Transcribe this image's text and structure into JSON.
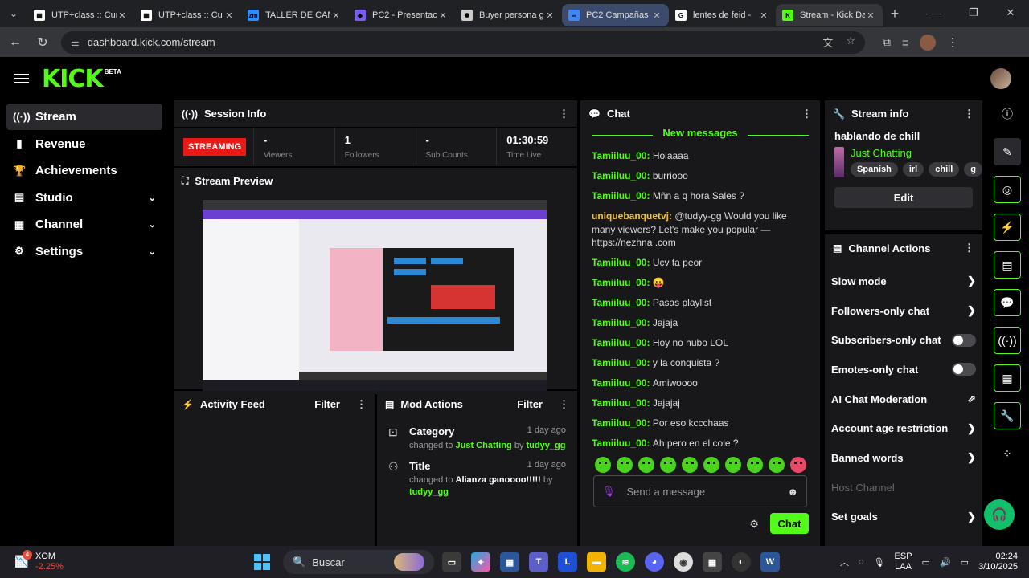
{
  "browser": {
    "tabs": [
      {
        "label": "UTP+class :: Cur",
        "fav_color": "#ffffff",
        "fav_char": "▦"
      },
      {
        "label": "UTP+class :: Cur",
        "fav_color": "#ffffff",
        "fav_char": "▦"
      },
      {
        "label": "TALLER DE CAM",
        "fav_color": "#2d8cff",
        "fav_char": "zm"
      },
      {
        "label": "PC2 - Presentaci",
        "fav_color": "#7b5cf0",
        "fav_char": "◆"
      },
      {
        "label": "Buyer persona g",
        "fav_color": "#cccccc",
        "fav_char": "✺"
      },
      {
        "label": "PC2 Campañas",
        "fav_color": "#4285f4",
        "fav_char": "≡"
      },
      {
        "label": "lentes de feid - ",
        "fav_color": "#ffffff",
        "fav_char": "G"
      },
      {
        "label": "Stream - Kick Da",
        "fav_color": "#53fc18",
        "fav_char": "K"
      }
    ],
    "url": "dashboard.kick.com/stream"
  },
  "app": {
    "logo": "KICK",
    "beta": "BETA",
    "nav": [
      {
        "label": "Stream",
        "icon": "((·))",
        "chevron": ""
      },
      {
        "label": "Revenue",
        "icon": "▮",
        "chevron": ""
      },
      {
        "label": "Achievements",
        "icon": "🏆",
        "chevron": ""
      },
      {
        "label": "Studio",
        "icon": "▤",
        "chevron": "⌄"
      },
      {
        "label": "Channel",
        "icon": "▦",
        "chevron": "⌄"
      },
      {
        "label": "Settings",
        "icon": "⚙",
        "chevron": "⌄"
      }
    ]
  },
  "session": {
    "title": "Session Info",
    "status": "STREAMING",
    "stats": [
      {
        "value": "-",
        "label": "Viewers"
      },
      {
        "value": "1",
        "label": "Followers"
      },
      {
        "value": "-",
        "label": "Sub Counts"
      },
      {
        "value": "01:30:59",
        "label": "Time Live"
      }
    ]
  },
  "preview": {
    "title": "Stream Preview"
  },
  "activity": {
    "title": "Activity Feed",
    "filter": "Filter"
  },
  "mod": {
    "title": "Mod Actions",
    "filter": "Filter",
    "entries": [
      {
        "title": "Category",
        "time": "1 day ago",
        "prefix": "changed to ",
        "value": "Just Chatting",
        "by": " by ",
        "user": "tudyy_gg"
      },
      {
        "title": "Title",
        "time": "1 day ago",
        "prefix": "changed to ",
        "value": "Alianza ganoooo!!!!!",
        "by": " by ",
        "user": "tudyy_gg"
      }
    ]
  },
  "chat": {
    "title": "Chat",
    "new_messages": "New messages",
    "messages": [
      {
        "user": "Tamiiluu_00",
        "text": "Holaaaa"
      },
      {
        "user": "Tamiiluu_00",
        "text": "burriooo"
      },
      {
        "user": "Tamiiluu_00",
        "text": "Mñn a q hora Sales ?"
      },
      {
        "user": "uniquebanquetvj",
        "text": "@tudyy-gg Would you like many viewers? Let's make you popular — https://nezhna .com"
      },
      {
        "user": "Tamiiluu_00",
        "text": "Ucv ta peor"
      },
      {
        "user": "Tamiiluu_00",
        "text": "😛"
      },
      {
        "user": "Tamiiluu_00",
        "text": "Pasas playlist"
      },
      {
        "user": "Tamiiluu_00",
        "text": "Jajaja"
      },
      {
        "user": "Tamiiluu_00",
        "text": "Hoy no hubo LOL"
      },
      {
        "user": "Tamiiluu_00",
        "text": "y la conquista ?"
      },
      {
        "user": "Tamiiluu_00",
        "text": "Amiwoooo"
      },
      {
        "user": "Tamiiluu_00",
        "text": "Jajajaj"
      },
      {
        "user": "Tamiiluu_00",
        "text": "Por eso kccchaas"
      },
      {
        "user": "Tamiiluu_00",
        "text": "Ah pero en el cole ?"
      }
    ],
    "placeholder": "Send a message",
    "send_label": "Chat"
  },
  "stream_info": {
    "title": "Stream info",
    "stream_title": "hablando de chill",
    "category": "Just Chatting",
    "tags": [
      "Spanish",
      "irl",
      "chill",
      "g"
    ],
    "edit_label": "Edit"
  },
  "channel_actions": {
    "title": "Channel Actions",
    "items": [
      {
        "label": "Slow mode",
        "control": "arrow"
      },
      {
        "label": "Followers-only chat",
        "control": "arrow"
      },
      {
        "label": "Subscribers-only chat",
        "control": "toggle"
      },
      {
        "label": "Emotes-only chat",
        "control": "toggle"
      },
      {
        "label": "AI Chat Moderation",
        "control": "external"
      },
      {
        "label": "Account age restriction",
        "control": "arrow"
      },
      {
        "label": "Banned words",
        "control": "arrow"
      },
      {
        "label": "Host Channel",
        "control": "disabled"
      },
      {
        "label": "Set goals",
        "control": "arrow"
      }
    ]
  },
  "taskbar": {
    "stock_name": "XOM",
    "stock_change": "-2.25%",
    "stock_badge": "4",
    "search": "Buscar",
    "lang_top": "ESP",
    "lang_bottom": "LAA",
    "time": "02:24",
    "date": "3/10/2025"
  }
}
